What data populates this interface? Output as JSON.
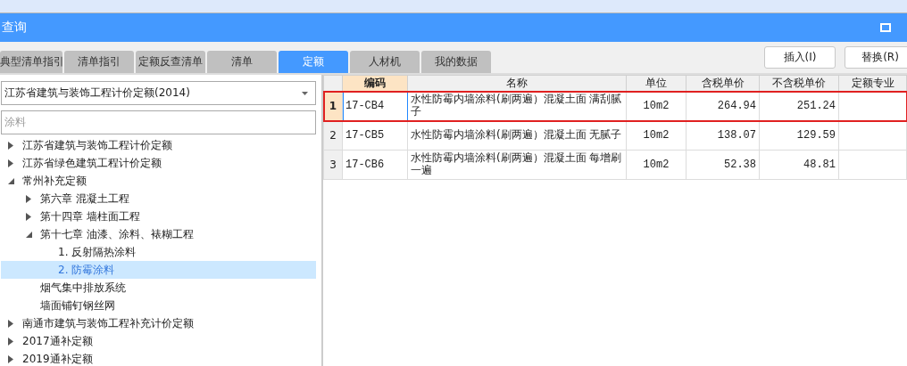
{
  "window": {
    "title": "查询"
  },
  "tabs": [
    {
      "label": "典型清单指引",
      "selected": false
    },
    {
      "label": "清单指引",
      "selected": false
    },
    {
      "label": "定额反查清单",
      "selected": false
    },
    {
      "label": "清单",
      "selected": false
    },
    {
      "label": "定额",
      "selected": true
    },
    {
      "label": "人材机",
      "selected": false
    },
    {
      "label": "我的数据",
      "selected": false
    }
  ],
  "buttons": [
    "插入(I)",
    "替换(R)"
  ],
  "library_select": {
    "value": "江苏省建筑与装饰工程计价定额(2014)"
  },
  "search": {
    "value": "涂料"
  },
  "tree": [
    {
      "label": "江苏省建筑与装饰工程计价定额",
      "expanded": false,
      "selected": false
    },
    {
      "label": "江苏省绿色建筑工程计价定额",
      "expanded": false,
      "selected": false
    },
    {
      "label": "常州补充定额",
      "expanded": true,
      "selected": false,
      "children": [
        {
          "label": "第六章 混凝土工程",
          "expanded": false,
          "selected": false
        },
        {
          "label": "第十四章 墙柱面工程",
          "expanded": false,
          "selected": false
        },
        {
          "label": "第十七章 油漆、涂料、裱糊工程",
          "expanded": true,
          "selected": false,
          "children": [
            {
              "label": "1. 反射隔热涂料",
              "selected": false
            },
            {
              "label": "2. 防霉涂料",
              "selected": true
            }
          ]
        },
        {
          "label": "烟气集中排放系统",
          "selected": false
        },
        {
          "label": "墙面铺钉钢丝网",
          "selected": false
        }
      ]
    },
    {
      "label": "南通市建筑与装饰工程补充计价定额",
      "expanded": false,
      "selected": false
    },
    {
      "label": "2017通补定额",
      "expanded": false,
      "selected": false
    },
    {
      "label": "2019通补定额",
      "expanded": false,
      "selected": false
    }
  ],
  "table": {
    "columns": [
      "编码",
      "名称",
      "单位",
      "含税单价",
      "不含税单价",
      "定额专业"
    ],
    "rows": [
      {
        "index": "1",
        "code": "17-CB4",
        "name": "水性防霉内墙涂料(刷两遍）混凝土面 满刮腻子",
        "unit": "10m2",
        "price_tax": "264.94",
        "price_notax": "251.24",
        "selected": true
      },
      {
        "index": "2",
        "code": "17-CB5",
        "name": "水性防霉内墙涂料(刷两遍）混凝土面 无腻子",
        "unit": "10m2",
        "price_tax": "138.07",
        "price_notax": "129.59",
        "selected": false
      },
      {
        "index": "3",
        "code": "17-CB6",
        "name": "水性防霉内墙涂料(刷两遍）混凝土面 每增刷一遍",
        "unit": "10m2",
        "price_tax": "52.38",
        "price_notax": "48.81",
        "selected": false
      }
    ]
  }
}
